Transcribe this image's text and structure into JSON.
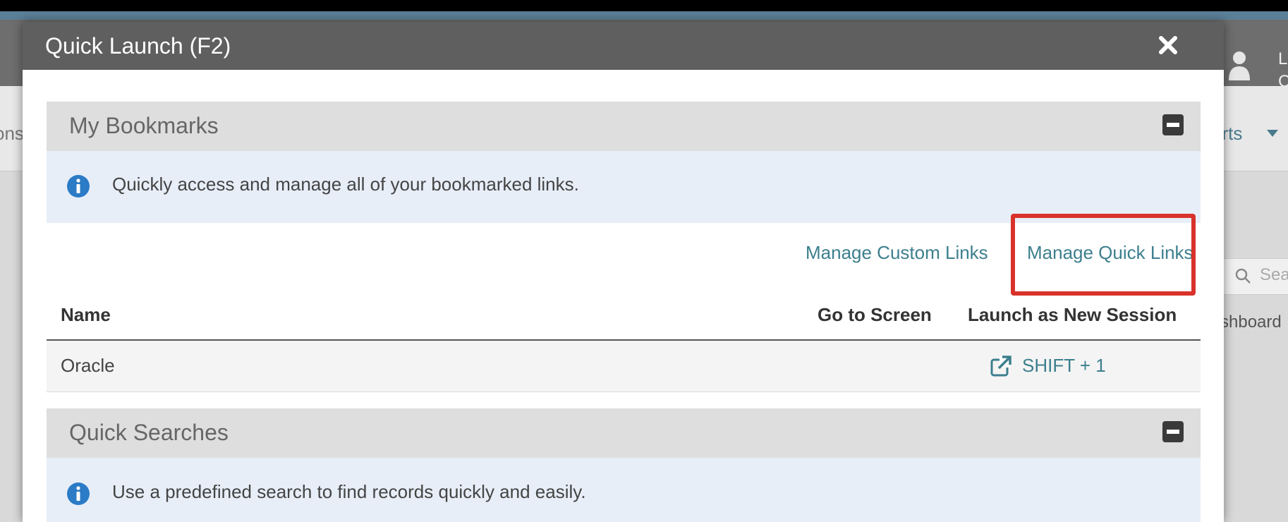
{
  "background": {
    "nav_left_text": "ons",
    "nav_right_text": "orts",
    "user_line1": "L",
    "user_line2": "C",
    "search_placeholder": "Sea",
    "side_text": "shboard"
  },
  "modal": {
    "title": "Quick Launch (F2)"
  },
  "bookmarks": {
    "title": "My Bookmarks",
    "info": "Quickly access and manage all of your bookmarked links.",
    "manage_custom_links": "Manage Custom Links",
    "manage_quick_links": "Manage Quick Links",
    "columns": [
      "Name",
      "Go to Screen",
      "Launch as New Session"
    ],
    "rows": [
      {
        "name": "Oracle",
        "go_to_screen": "",
        "launch_shortcut": "SHIFT + 1"
      }
    ]
  },
  "quick_searches": {
    "title": "Quick Searches",
    "info": "Use a predefined search to find records quickly and easily."
  },
  "colors": {
    "header": "#5f5f5f",
    "section_header": "#dedede",
    "info_bg": "#e7eef8",
    "link": "#3d7f8e",
    "highlight": "#d9322b",
    "info_icon": "#2b7bc6"
  }
}
